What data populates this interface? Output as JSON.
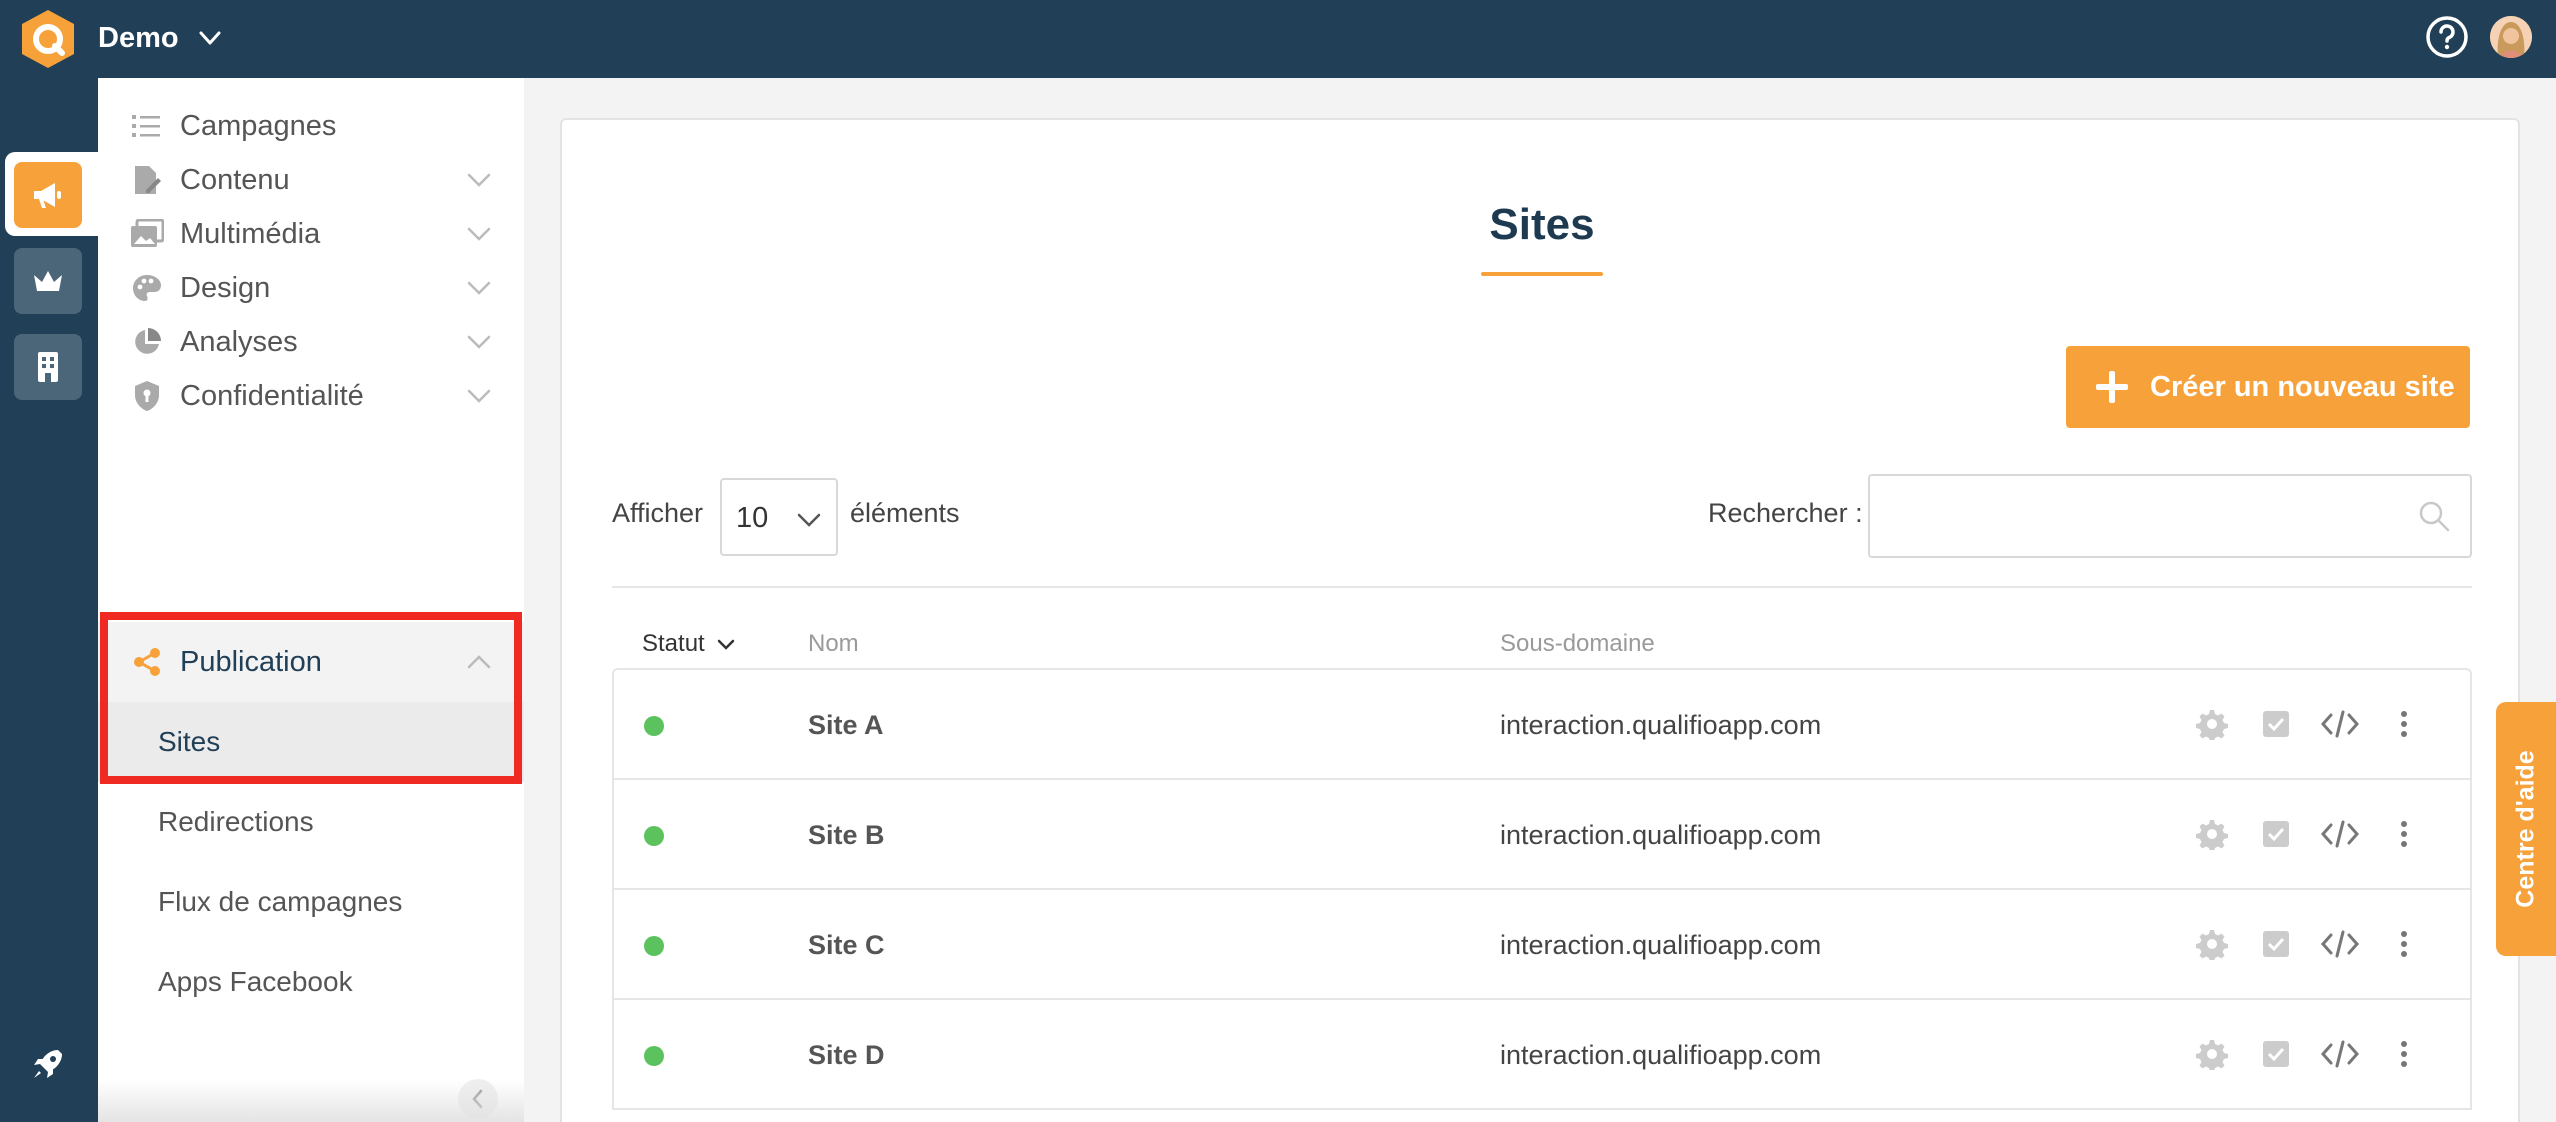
{
  "topbar": {
    "account_name": "Demo",
    "logo_icon": "qualifio-logo-icon",
    "help_icon": "help-circle-icon",
    "avatar_icon": "user-avatar"
  },
  "rail": {
    "items": [
      {
        "icon": "megaphone-icon",
        "active": true
      },
      {
        "icon": "crown-icon",
        "active": false
      },
      {
        "icon": "building-icon",
        "active": false
      }
    ],
    "bottom_icon": "rocket-icon"
  },
  "sidebar": {
    "items": [
      {
        "label": "Campagnes",
        "icon": "list-icon",
        "expandable": false
      },
      {
        "label": "Contenu",
        "icon": "document-edit-icon",
        "expandable": true
      },
      {
        "label": "Multimédia",
        "icon": "images-icon",
        "expandable": true
      },
      {
        "label": "Design",
        "icon": "palette-icon",
        "expandable": true
      },
      {
        "label": "Analyses",
        "icon": "pie-chart-icon",
        "expandable": true
      },
      {
        "label": "Confidentialité",
        "icon": "shield-icon",
        "expandable": true
      },
      {
        "label": "Publication",
        "icon": "share-icon",
        "expandable": true,
        "open": true
      }
    ],
    "publication_subitems": [
      {
        "label": "Sites",
        "current": true
      },
      {
        "label": "Redirections"
      },
      {
        "label": "Flux de campagnes"
      },
      {
        "label": "Apps Facebook"
      }
    ]
  },
  "main": {
    "title": "Sites",
    "create_button": "Créer un nouveau site",
    "length": {
      "label_before": "Afficher",
      "value": "10",
      "label_after": "éléments"
    },
    "search": {
      "label": "Rechercher :",
      "value": "",
      "placeholder": ""
    },
    "columns": {
      "status": "Statut",
      "name": "Nom",
      "subdomain": "Sous-domaine"
    },
    "rows": [
      {
        "status": "active",
        "name": "Site A",
        "subdomain": "interaction.qualifioapp.com"
      },
      {
        "status": "active",
        "name": "Site B",
        "subdomain": "interaction.qualifioapp.com"
      },
      {
        "status": "active",
        "name": "Site C",
        "subdomain": "interaction.qualifioapp.com"
      },
      {
        "status": "active",
        "name": "Site D",
        "subdomain": "interaction.qualifioapp.com"
      }
    ],
    "row_actions": [
      "gear-icon",
      "checkbox-icon",
      "code-icon",
      "more-vertical-icon"
    ]
  },
  "help_tab": {
    "label": "Centre d'aide"
  },
  "colors": {
    "navy": "#213f56",
    "accent": "#f7a13a",
    "status_active": "#5cc25d",
    "highlight": "#ee2a22"
  }
}
